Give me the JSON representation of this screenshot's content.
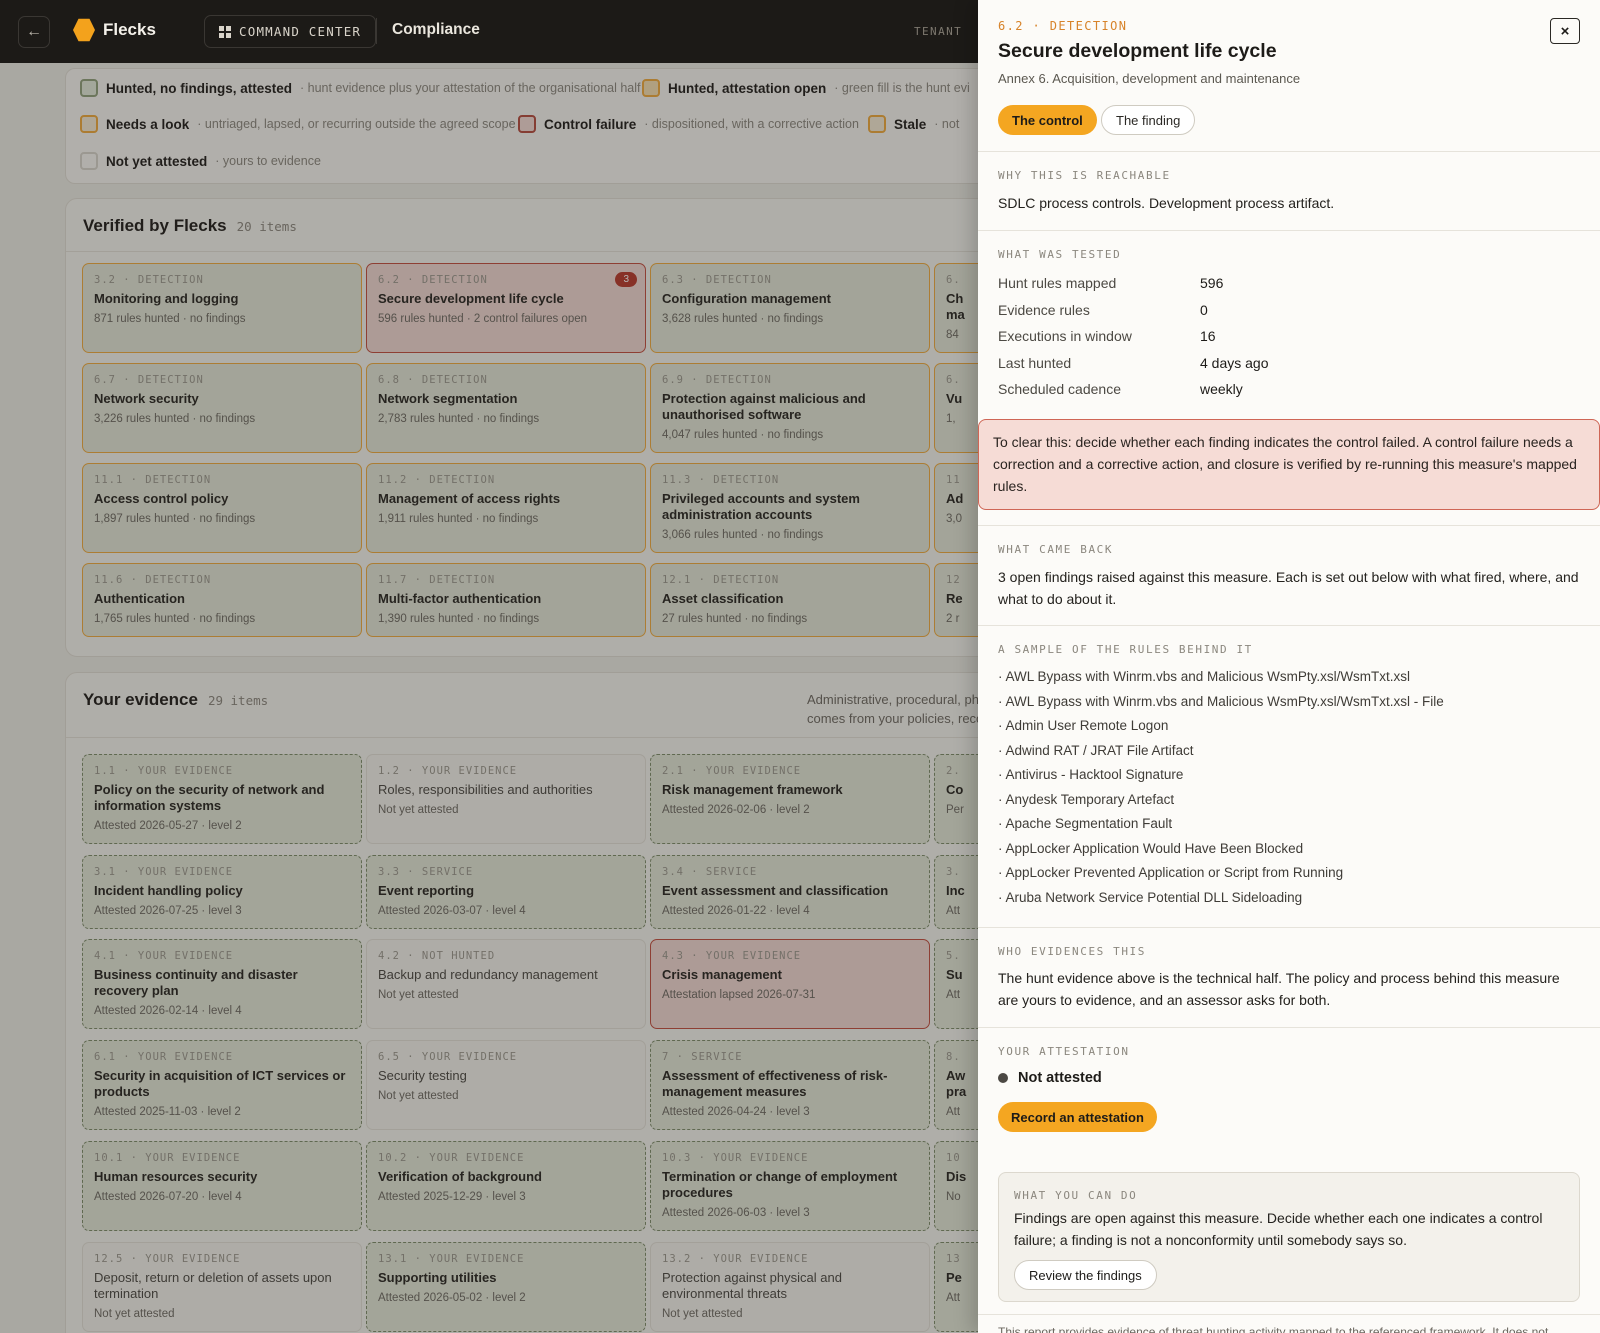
{
  "topbar": {
    "back_icon": "arrow-left-icon",
    "brand": "Flecks",
    "command_center": "COMMAND CENTER",
    "breadcrumb": "Compliance",
    "tenant_label": "TENANT"
  },
  "legend": [
    {
      "label": "Hunted, no findings, attested",
      "desc": "· hunt evidence plus your attestation of the organisational half"
    },
    {
      "label": "Hunted, attestation open",
      "desc": "· green fill is the hunt evi"
    },
    {
      "label": "Needs a look",
      "desc": "· untriaged, lapsed, or recurring outside the agreed scope"
    },
    {
      "label": "Control failure",
      "desc": "· dispositioned, with a corrective action"
    },
    {
      "label": "Stale",
      "desc": "· not"
    },
    {
      "label": "Not yet attested",
      "desc": "· yours to evidence"
    }
  ],
  "verified": {
    "title": "Verified by Flecks",
    "count": "20 items",
    "cards": [
      {
        "kicker": "3.2 · DETECTION",
        "title": "Monitoring and logging",
        "meta": "871 rules hunted · no findings"
      },
      {
        "kicker": "6.2 · DETECTION",
        "title": "Secure development life cycle",
        "meta": "596 rules hunted · 2 control failures open",
        "badge": "3"
      },
      {
        "kicker": "6.3 · DETECTION",
        "title": "Configuration management",
        "meta": "3,628 rules hunted · no findings"
      },
      {
        "kicker": "6.",
        "title": "Ch",
        "title2": "ma",
        "meta": "84"
      },
      {
        "kicker": "6.7 · DETECTION",
        "title": "Network security",
        "meta": "3,226 rules hunted · no findings"
      },
      {
        "kicker": "6.8 · DETECTION",
        "title": "Network segmentation",
        "meta": "2,783 rules hunted · no findings"
      },
      {
        "kicker": "6.9 · DETECTION",
        "title": "Protection against malicious and unauthorised software",
        "meta": "4,047 rules hunted · no findings"
      },
      {
        "kicker": "6.",
        "title": "Vu",
        "meta": "1,"
      },
      {
        "kicker": "11.1 · DETECTION",
        "title": "Access control policy",
        "meta": "1,897 rules hunted · no findings"
      },
      {
        "kicker": "11.2 · DETECTION",
        "title": "Management of access rights",
        "meta": "1,911 rules hunted · no findings"
      },
      {
        "kicker": "11.3 · DETECTION",
        "title": "Privileged accounts and system administration accounts",
        "meta": "3,066 rules hunted · no findings"
      },
      {
        "kicker": "11",
        "title": "Ad",
        "meta": "3,0"
      },
      {
        "kicker": "11.6 · DETECTION",
        "title": "Authentication",
        "meta": "1,765 rules hunted · no findings"
      },
      {
        "kicker": "11.7 · DETECTION",
        "title": "Multi-factor authentication",
        "meta": "1,390 rules hunted · no findings"
      },
      {
        "kicker": "12.1 · DETECTION",
        "title": "Asset classification",
        "meta": "27 rules hunted · no findings"
      },
      {
        "kicker": "12",
        "title": "Re",
        "meta": "2 r"
      }
    ]
  },
  "evidence": {
    "title": "Your evidence",
    "count": "29 items",
    "note1": "Administrative, procedural, ph",
    "note2": "comes from your policies, reco",
    "cards": [
      {
        "kicker": "1.1 · YOUR EVIDENCE",
        "title": "Policy on the security of network and information systems",
        "meta": "Attested 2026-05-27 · level 2"
      },
      {
        "kicker": "1.2 · YOUR EVIDENCE",
        "title": "Roles, responsibilities and authorities",
        "meta": "Not yet attested"
      },
      {
        "kicker": "2.1 · YOUR EVIDENCE",
        "title": "Risk management framework",
        "meta": "Attested 2026-02-06 · level 2"
      },
      {
        "kicker": "2.",
        "title": "Co",
        "meta": "Per"
      },
      {
        "kicker": "3.1 · YOUR EVIDENCE",
        "title": "Incident handling policy",
        "meta": "Attested 2026-07-25 · level 3"
      },
      {
        "kicker": "3.3 · SERVICE",
        "title": "Event reporting",
        "meta": "Attested 2026-03-07 · level 4"
      },
      {
        "kicker": "3.4 · SERVICE",
        "title": "Event assessment and classification",
        "meta": "Attested 2026-01-22 · level 4"
      },
      {
        "kicker": "3.",
        "title": "Inc",
        "meta": "Att"
      },
      {
        "kicker": "4.1 · YOUR EVIDENCE",
        "title": "Business continuity and disaster recovery plan",
        "meta": "Attested 2026-02-14 · level 4"
      },
      {
        "kicker": "4.2 · NOT HUNTED",
        "title": "Backup and redundancy management",
        "meta": "Not yet attested"
      },
      {
        "kicker": "4.3 · YOUR EVIDENCE",
        "title": "Crisis management",
        "meta": "Attestation lapsed 2026-07-31"
      },
      {
        "kicker": "5.",
        "title": "Su",
        "meta": "Att"
      },
      {
        "kicker": "6.1 · YOUR EVIDENCE",
        "title": "Security in acquisition of ICT services or products",
        "meta": "Attested 2025-11-03 · level 2"
      },
      {
        "kicker": "6.5 · YOUR EVIDENCE",
        "title": "Security testing",
        "meta": "Not yet attested"
      },
      {
        "kicker": "7 · SERVICE",
        "title": "Assessment of effectiveness of risk-management measures",
        "meta": "Attested 2026-04-24 · level 3"
      },
      {
        "kicker": "8.",
        "title": "Aw",
        "title2": "pra",
        "meta": "Att"
      },
      {
        "kicker": "10.1 · YOUR EVIDENCE",
        "title": "Human resources security",
        "meta": "Attested 2026-07-20 · level 4"
      },
      {
        "kicker": "10.2 · YOUR EVIDENCE",
        "title": "Verification of background",
        "meta": "Attested 2025-12-29 · level 3"
      },
      {
        "kicker": "10.3 · YOUR EVIDENCE",
        "title": "Termination or change of employment procedures",
        "meta": "Attested 2026-06-03 · level 3"
      },
      {
        "kicker": "10",
        "title": "Dis",
        "meta": "No"
      },
      {
        "kicker": "12.5 · YOUR EVIDENCE",
        "title": "Deposit, return or deletion of assets upon termination",
        "meta": "Not yet attested"
      },
      {
        "kicker": "13.1 · YOUR EVIDENCE",
        "title": "Supporting utilities",
        "meta": "Attested 2026-05-02 · level 2"
      },
      {
        "kicker": "13.2 · YOUR EVIDENCE",
        "title": "Protection against physical and environmental threats",
        "meta": "Not yet attested"
      },
      {
        "kicker": "13",
        "title": "Pe",
        "meta": "Att"
      }
    ]
  },
  "drawer": {
    "kicker": "6.2 · DETECTION",
    "title": "Secure development life cycle",
    "subtitle": "Annex 6. Acquisition, development and maintenance",
    "close_icon": "close-icon",
    "close_glyph": "×",
    "tab_control": "The control",
    "tab_finding": "The finding",
    "why_label": "WHY THIS IS REACHABLE",
    "why_text": "SDLC process controls. Development process artifact.",
    "tested_label": "WHAT WAS TESTED",
    "tested": [
      {
        "k": "Hunt rules mapped",
        "v": "596"
      },
      {
        "k": "Evidence rules",
        "v": "0"
      },
      {
        "k": "Executions in window",
        "v": "16"
      },
      {
        "k": "Last hunted",
        "v": "4 days ago"
      },
      {
        "k": "Scheduled cadence",
        "v": "weekly"
      }
    ],
    "alert": "To clear this: decide whether each finding indicates the control failed. A control failure needs a correction and a corrective action, and closure is verified by re-running this measure's mapped rules.",
    "back_label": "WHAT CAME BACK",
    "back_text": "3 open findings raised against this measure. Each is set out below with what fired, where, and what to do about it.",
    "rules_label": "A SAMPLE OF THE RULES BEHIND IT",
    "rules": [
      "· AWL Bypass with Winrm.vbs and Malicious WsmPty.xsl/WsmTxt.xsl",
      "· AWL Bypass with Winrm.vbs and Malicious WsmPty.xsl/WsmTxt.xsl - File",
      "· Admin User Remote Logon",
      "· Adwind RAT / JRAT File Artifact",
      "· Antivirus - Hacktool Signature",
      "· Anydesk Temporary Artefact",
      "· Apache Segmentation Fault",
      "· AppLocker Application Would Have Been Blocked",
      "· AppLocker Prevented Application or Script from Running",
      "· Aruba Network Service Potential DLL Sideloading"
    ],
    "who_label": "WHO EVIDENCES THIS",
    "who_text": "The hunt evidence above is the technical half. The policy and process behind this measure are yours to evidence, and an assessor asks for both.",
    "att_label": "YOUR ATTESTATION",
    "att_status": "Not attested",
    "att_button": "Record an attestation",
    "todo_label": "WHAT YOU CAN DO",
    "todo_text": "Findings are open against this measure. Decide whether each one indicates a control failure; a finding is not a nonconformity until somebody says so.",
    "todo_button": "Review the findings",
    "footnote": "This report provides evidence of threat hunting activity mapped to the referenced framework. It does not"
  }
}
